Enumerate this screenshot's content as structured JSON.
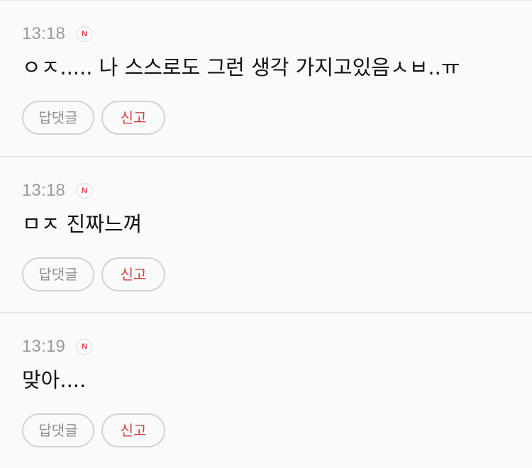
{
  "comments": [
    {
      "time": "13:18",
      "badge": "N",
      "text": "ㅇㅈ..... 나 스스로도 그런 생각 가지고있음ㅅㅂ..ㅠ",
      "reply_label": "답댓글",
      "report_label": "신고"
    },
    {
      "time": "13:18",
      "badge": "N",
      "text": "ㅁㅈ 진짜느껴",
      "reply_label": "답댓글",
      "report_label": "신고"
    },
    {
      "time": "13:19",
      "badge": "N",
      "text": "맞아....",
      "reply_label": "답댓글",
      "report_label": "신고"
    }
  ],
  "colors": {
    "background": "#fafafa",
    "badge_text": "#e8343a",
    "report_text": "#d63b3b",
    "muted_text": "#9a9a9a"
  }
}
